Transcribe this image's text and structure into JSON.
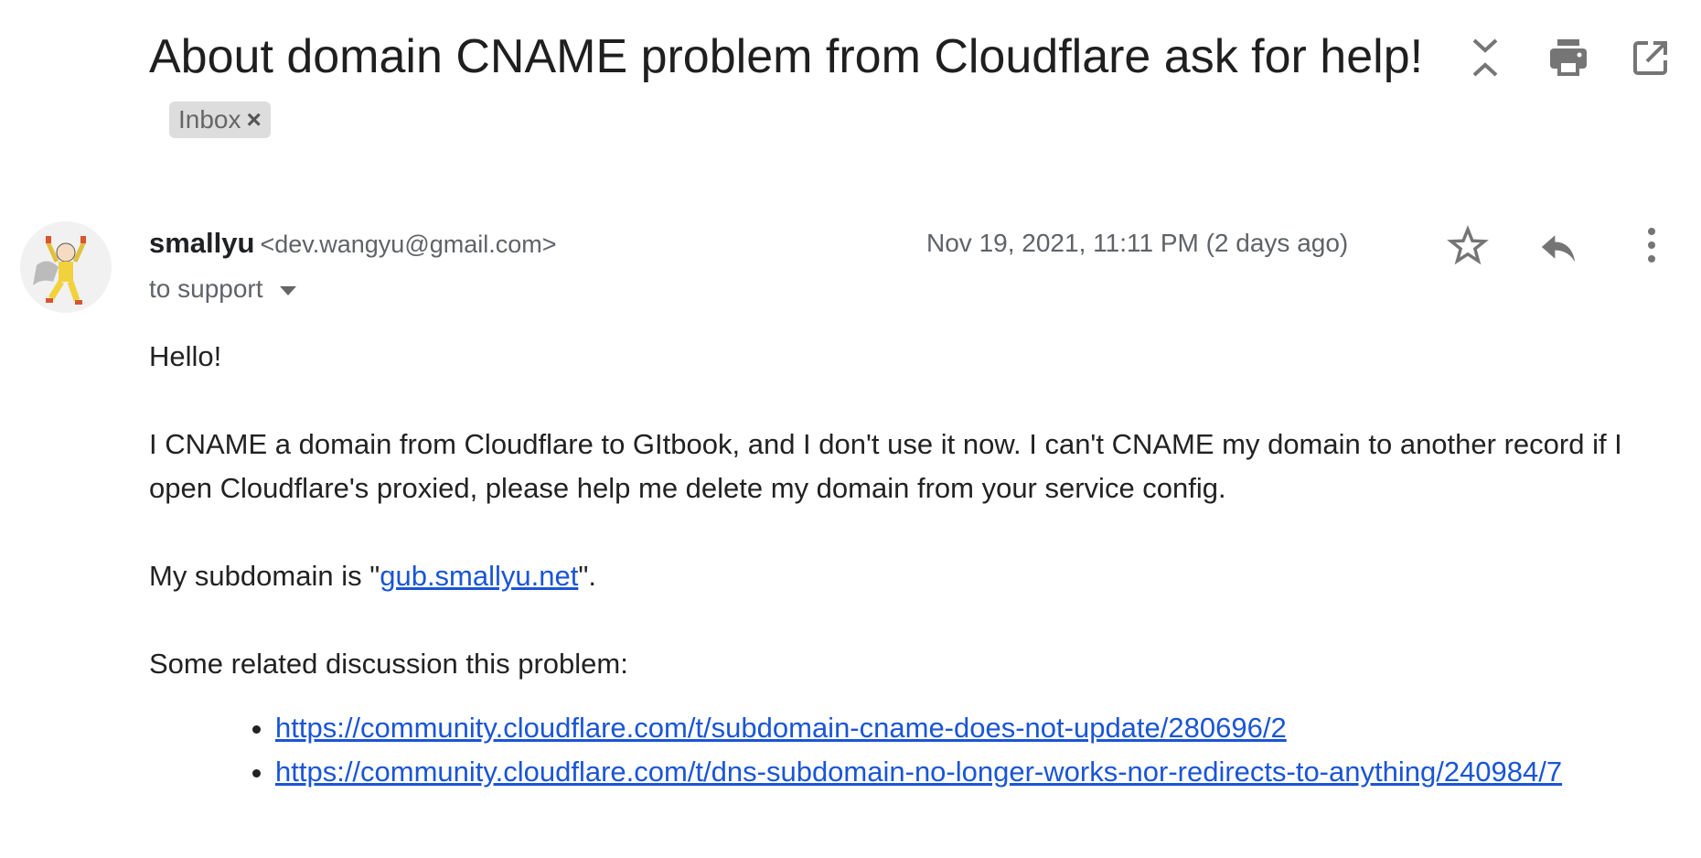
{
  "header": {
    "subject": "About domain CNAME problem from Cloudflare ask for help!",
    "label_chip": "Inbox",
    "label_remove": "×",
    "icons": [
      "collapse-all-icon",
      "print-icon",
      "open-in-new-window-icon"
    ]
  },
  "message": {
    "sender_name": "smallyu",
    "sender_email": "<dev.wangyu@gmail.com>",
    "recipients": "to support",
    "date": "Nov 19, 2021, 11:11 PM (2 days ago)",
    "icons": [
      "star-icon",
      "reply-icon",
      "more-vert-icon"
    ]
  },
  "body": {
    "greeting": "Hello!",
    "paragraph1": "I CNAME a domain from Cloudflare to GItbook, and I don't use it now. I can't CNAME my domain to another record if I open Cloudflare's proxied, please help me delete my domain from your service config.",
    "subdomain_prefix": "My subdomain is \"",
    "subdomain_link": "gub.smallyu.net",
    "subdomain_suffix": "\".",
    "related_intro": "Some related discussion this problem:",
    "links": [
      "https://community.cloudflare.com/t/subdomain-cname-does-not-update/280696/2",
      "https://community.cloudflare.com/t/dns-subdomain-no-longer-works-nor-redirects-to-anything/240984/7"
    ]
  },
  "colors": {
    "link": "#1a55d6",
    "icon": "#757575",
    "chip_bg": "#dddddd"
  }
}
